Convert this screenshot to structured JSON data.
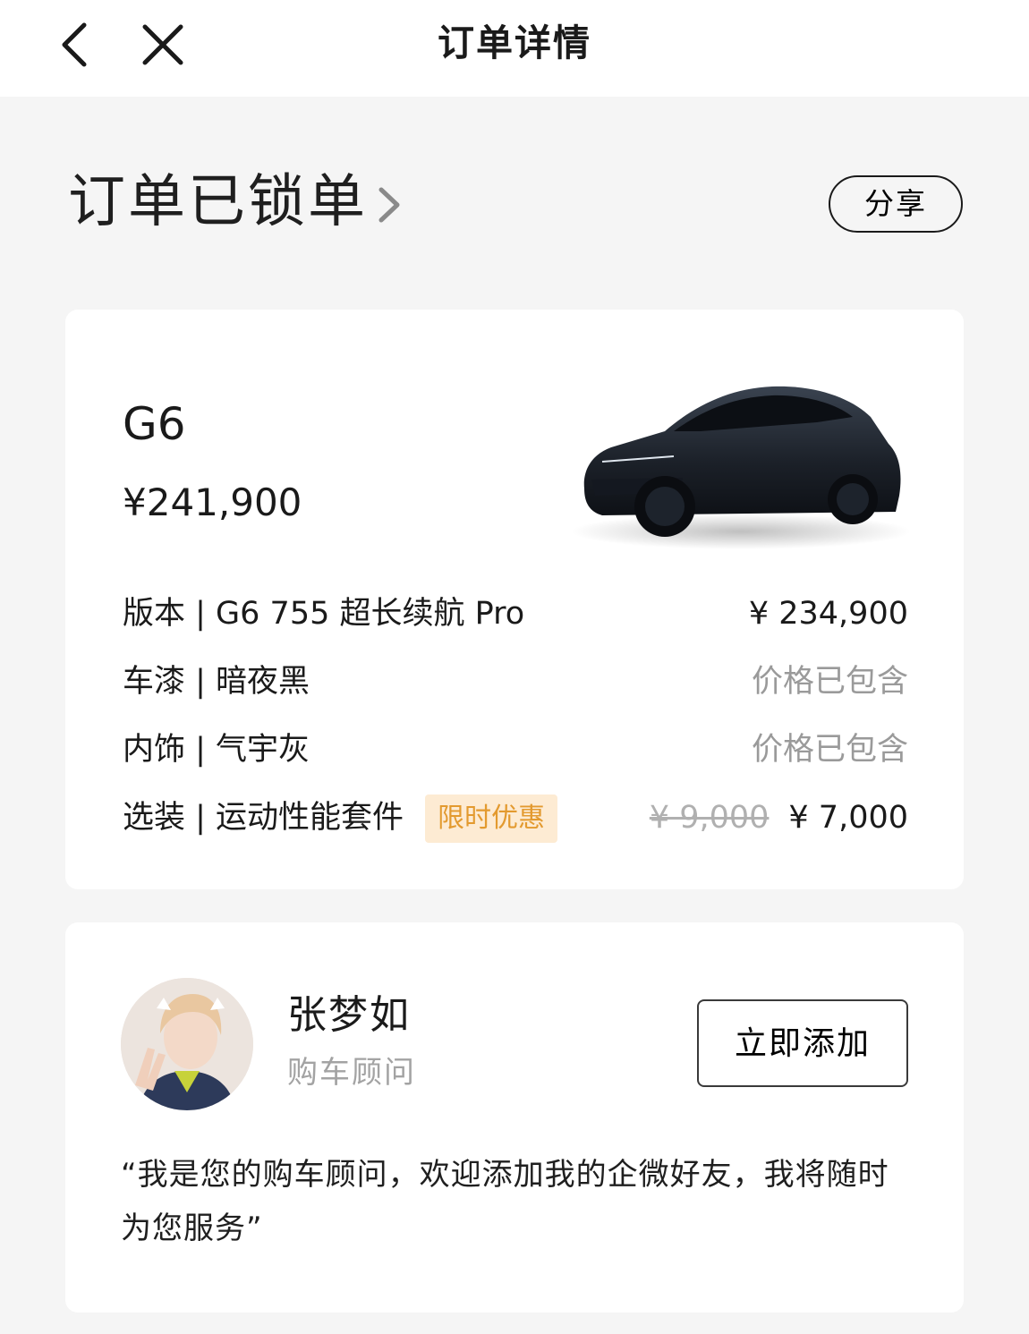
{
  "header": {
    "title": "订单详情"
  },
  "status": {
    "title": "订单已锁单",
    "share_label": "分享"
  },
  "order": {
    "model": "G6",
    "price": "¥241,900",
    "specs": [
      {
        "label": "版本 | G6 755 超长续航 Pro",
        "price": "¥ 234,900"
      },
      {
        "label": "车漆 | 暗夜黑",
        "price": "价格已包含"
      },
      {
        "label": "内饰 | 气宇灰",
        "price": "价格已包含"
      },
      {
        "label": "选装 | 运动性能套件",
        "badge": "限时优惠",
        "original_price": "¥ 9,000",
        "price": "¥ 7,000"
      }
    ]
  },
  "advisor": {
    "name": "张梦如",
    "role": "购车顾问",
    "add_label": "立即添加",
    "message": "“我是您的购车顾问，欢迎添加我的企微好友，我将随时为您服务”"
  },
  "colors": {
    "background": "#f5f5f5",
    "card": "#ffffff",
    "promo_bg": "#fdebd3",
    "promo_text": "#e39a2f",
    "muted_text": "#9a9a9a"
  }
}
